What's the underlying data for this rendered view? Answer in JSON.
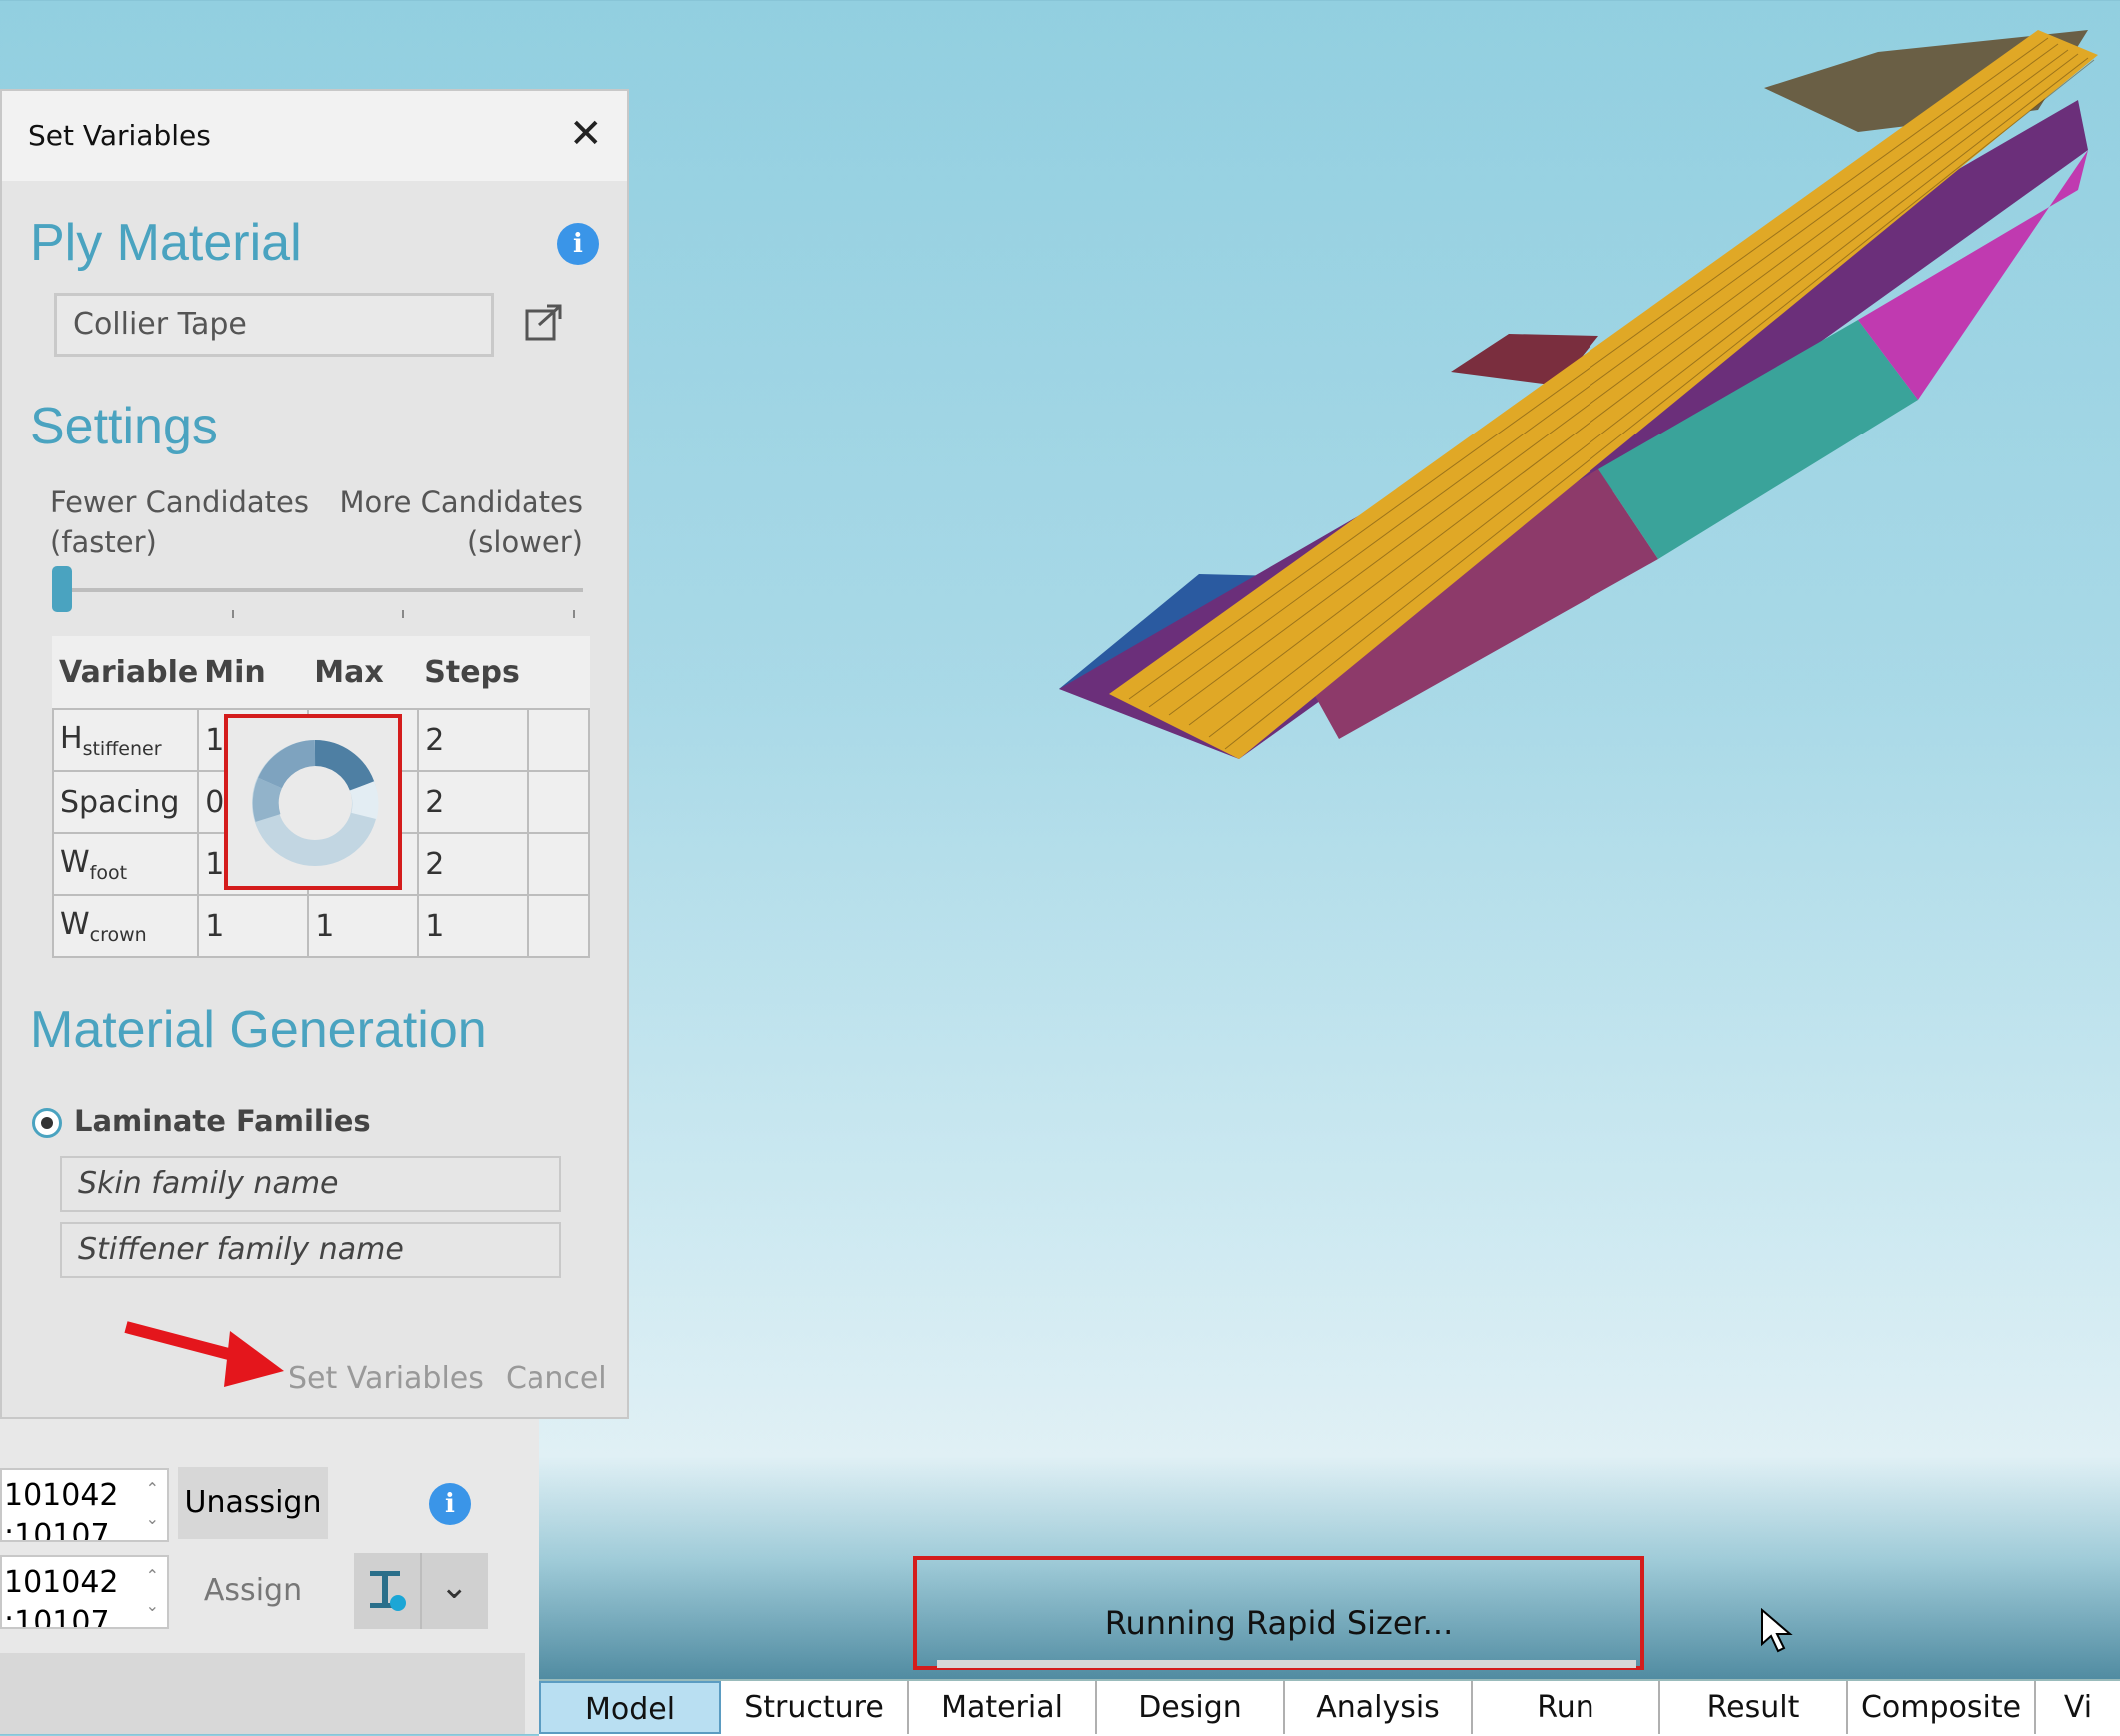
{
  "dialog": {
    "title": "Set Variables",
    "close_glyph": "✕",
    "ply_material": {
      "heading": "Ply Material",
      "value": "Collier Tape"
    },
    "settings": {
      "heading": "Settings",
      "left_label_1": "Fewer Candidates",
      "left_label_2": "(faster)",
      "right_label_1": "More Candidates",
      "right_label_2": "(slower)",
      "slider_position": 0
    },
    "table": {
      "headers": [
        "Variable",
        "Min",
        "Max",
        "Steps"
      ],
      "rows": [
        {
          "var_main": "H",
          "var_sub": "stiffener",
          "min": "1",
          "max": "",
          "steps": "2"
        },
        {
          "var_main": "Spacing",
          "var_sub": "",
          "min": "0.",
          "max": "",
          "steps": "2"
        },
        {
          "var_main": "W",
          "var_sub": "foot",
          "min": "1",
          "max": "",
          "steps": "2"
        },
        {
          "var_main": "W",
          "var_sub": "crown",
          "min": "1",
          "max": "1",
          "steps": "1"
        }
      ]
    },
    "material_generation": {
      "heading": "Material Generation",
      "radio_label": "Laminate Families",
      "radio_selected": true,
      "skin_placeholder": "Skin family name",
      "stiffener_placeholder": "Stiffener family name"
    },
    "set_button": "Set Variables",
    "cancel_button": "Cancel"
  },
  "lower_panel": {
    "row1_value_a": "101042",
    "row1_value_b": ":10107",
    "row2_value_a": "101042",
    "row2_value_b": ":10107",
    "unassign": "Unassign",
    "assign": "Assign"
  },
  "status": {
    "text": "Running Rapid Sizer..."
  },
  "tabs": [
    "Model",
    "Structure",
    "Material",
    "Design",
    "Analysis",
    "Run",
    "Result",
    "Composite",
    "Vi"
  ],
  "active_tab": "Model",
  "colors": {
    "accent": "#4aa3c0",
    "highlight_red": "#d41c1c",
    "info_blue": "#3a95e8",
    "active_tab": "#b9dff2"
  }
}
